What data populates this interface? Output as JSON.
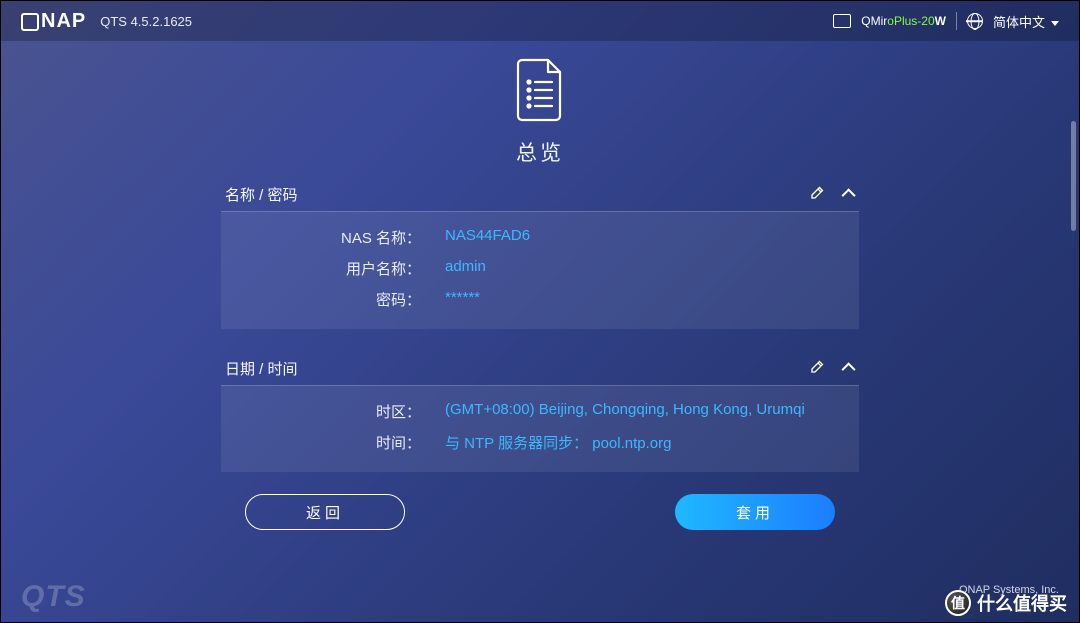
{
  "header": {
    "brand": "NAP",
    "version": "QTS 4.5.2.1625",
    "device_name_prefix": "QMir",
    "device_name_green": "oPlus-20",
    "device_name_suffix": "W",
    "language": "简体中文"
  },
  "overview": {
    "title": "总览",
    "name_pw_section": "名称 / 密码",
    "date_time_section": "日期 / 时间",
    "fields": {
      "nas_name_label": "NAS 名称：",
      "nas_name_value": "NAS44FAD6",
      "username_label": "用户名称：",
      "username_value": "admin",
      "password_label": "密码：",
      "password_value": "******",
      "timezone_label": "时区：",
      "timezone_value": "(GMT+08:00) Beijing, Chongqing, Hong Kong, Urumqi",
      "time_label": "时间：",
      "time_value": "与 NTP 服务器同步： pool.ntp.org"
    }
  },
  "buttons": {
    "back": "返回",
    "apply": "套用"
  },
  "footer": {
    "logo": "QTS",
    "copyright": "QNAP Systems, Inc."
  },
  "watermark": "什么值得买"
}
